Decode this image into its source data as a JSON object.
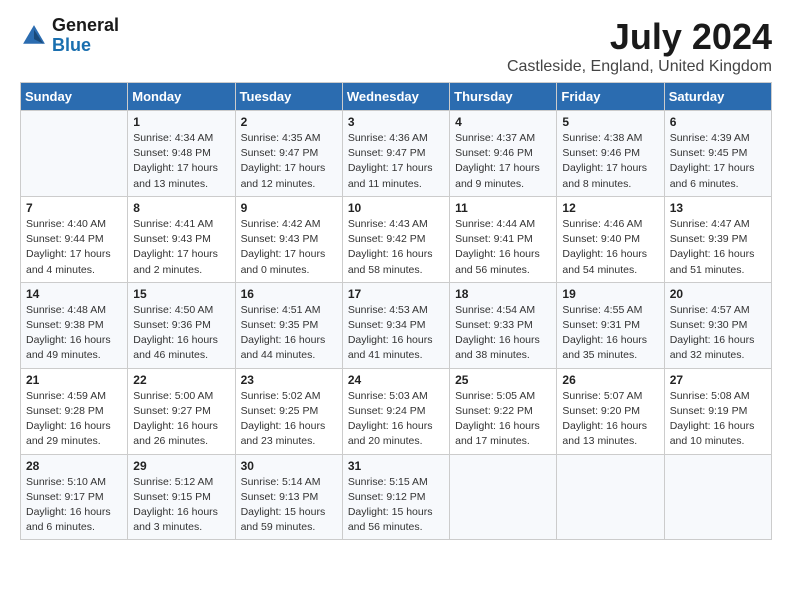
{
  "logo": {
    "general": "General",
    "blue": "Blue"
  },
  "title": "July 2024",
  "subtitle": "Castleside, England, United Kingdom",
  "headers": [
    "Sunday",
    "Monday",
    "Tuesday",
    "Wednesday",
    "Thursday",
    "Friday",
    "Saturday"
  ],
  "weeks": [
    [
      {
        "num": "",
        "sunrise": "",
        "sunset": "",
        "daylight": ""
      },
      {
        "num": "1",
        "sunrise": "Sunrise: 4:34 AM",
        "sunset": "Sunset: 9:48 PM",
        "daylight": "Daylight: 17 hours and 13 minutes."
      },
      {
        "num": "2",
        "sunrise": "Sunrise: 4:35 AM",
        "sunset": "Sunset: 9:47 PM",
        "daylight": "Daylight: 17 hours and 12 minutes."
      },
      {
        "num": "3",
        "sunrise": "Sunrise: 4:36 AM",
        "sunset": "Sunset: 9:47 PM",
        "daylight": "Daylight: 17 hours and 11 minutes."
      },
      {
        "num": "4",
        "sunrise": "Sunrise: 4:37 AM",
        "sunset": "Sunset: 9:46 PM",
        "daylight": "Daylight: 17 hours and 9 minutes."
      },
      {
        "num": "5",
        "sunrise": "Sunrise: 4:38 AM",
        "sunset": "Sunset: 9:46 PM",
        "daylight": "Daylight: 17 hours and 8 minutes."
      },
      {
        "num": "6",
        "sunrise": "Sunrise: 4:39 AM",
        "sunset": "Sunset: 9:45 PM",
        "daylight": "Daylight: 17 hours and 6 minutes."
      }
    ],
    [
      {
        "num": "7",
        "sunrise": "Sunrise: 4:40 AM",
        "sunset": "Sunset: 9:44 PM",
        "daylight": "Daylight: 17 hours and 4 minutes."
      },
      {
        "num": "8",
        "sunrise": "Sunrise: 4:41 AM",
        "sunset": "Sunset: 9:43 PM",
        "daylight": "Daylight: 17 hours and 2 minutes."
      },
      {
        "num": "9",
        "sunrise": "Sunrise: 4:42 AM",
        "sunset": "Sunset: 9:43 PM",
        "daylight": "Daylight: 17 hours and 0 minutes."
      },
      {
        "num": "10",
        "sunrise": "Sunrise: 4:43 AM",
        "sunset": "Sunset: 9:42 PM",
        "daylight": "Daylight: 16 hours and 58 minutes."
      },
      {
        "num": "11",
        "sunrise": "Sunrise: 4:44 AM",
        "sunset": "Sunset: 9:41 PM",
        "daylight": "Daylight: 16 hours and 56 minutes."
      },
      {
        "num": "12",
        "sunrise": "Sunrise: 4:46 AM",
        "sunset": "Sunset: 9:40 PM",
        "daylight": "Daylight: 16 hours and 54 minutes."
      },
      {
        "num": "13",
        "sunrise": "Sunrise: 4:47 AM",
        "sunset": "Sunset: 9:39 PM",
        "daylight": "Daylight: 16 hours and 51 minutes."
      }
    ],
    [
      {
        "num": "14",
        "sunrise": "Sunrise: 4:48 AM",
        "sunset": "Sunset: 9:38 PM",
        "daylight": "Daylight: 16 hours and 49 minutes."
      },
      {
        "num": "15",
        "sunrise": "Sunrise: 4:50 AM",
        "sunset": "Sunset: 9:36 PM",
        "daylight": "Daylight: 16 hours and 46 minutes."
      },
      {
        "num": "16",
        "sunrise": "Sunrise: 4:51 AM",
        "sunset": "Sunset: 9:35 PM",
        "daylight": "Daylight: 16 hours and 44 minutes."
      },
      {
        "num": "17",
        "sunrise": "Sunrise: 4:53 AM",
        "sunset": "Sunset: 9:34 PM",
        "daylight": "Daylight: 16 hours and 41 minutes."
      },
      {
        "num": "18",
        "sunrise": "Sunrise: 4:54 AM",
        "sunset": "Sunset: 9:33 PM",
        "daylight": "Daylight: 16 hours and 38 minutes."
      },
      {
        "num": "19",
        "sunrise": "Sunrise: 4:55 AM",
        "sunset": "Sunset: 9:31 PM",
        "daylight": "Daylight: 16 hours and 35 minutes."
      },
      {
        "num": "20",
        "sunrise": "Sunrise: 4:57 AM",
        "sunset": "Sunset: 9:30 PM",
        "daylight": "Daylight: 16 hours and 32 minutes."
      }
    ],
    [
      {
        "num": "21",
        "sunrise": "Sunrise: 4:59 AM",
        "sunset": "Sunset: 9:28 PM",
        "daylight": "Daylight: 16 hours and 29 minutes."
      },
      {
        "num": "22",
        "sunrise": "Sunrise: 5:00 AM",
        "sunset": "Sunset: 9:27 PM",
        "daylight": "Daylight: 16 hours and 26 minutes."
      },
      {
        "num": "23",
        "sunrise": "Sunrise: 5:02 AM",
        "sunset": "Sunset: 9:25 PM",
        "daylight": "Daylight: 16 hours and 23 minutes."
      },
      {
        "num": "24",
        "sunrise": "Sunrise: 5:03 AM",
        "sunset": "Sunset: 9:24 PM",
        "daylight": "Daylight: 16 hours and 20 minutes."
      },
      {
        "num": "25",
        "sunrise": "Sunrise: 5:05 AM",
        "sunset": "Sunset: 9:22 PM",
        "daylight": "Daylight: 16 hours and 17 minutes."
      },
      {
        "num": "26",
        "sunrise": "Sunrise: 5:07 AM",
        "sunset": "Sunset: 9:20 PM",
        "daylight": "Daylight: 16 hours and 13 minutes."
      },
      {
        "num": "27",
        "sunrise": "Sunrise: 5:08 AM",
        "sunset": "Sunset: 9:19 PM",
        "daylight": "Daylight: 16 hours and 10 minutes."
      }
    ],
    [
      {
        "num": "28",
        "sunrise": "Sunrise: 5:10 AM",
        "sunset": "Sunset: 9:17 PM",
        "daylight": "Daylight: 16 hours and 6 minutes."
      },
      {
        "num": "29",
        "sunrise": "Sunrise: 5:12 AM",
        "sunset": "Sunset: 9:15 PM",
        "daylight": "Daylight: 16 hours and 3 minutes."
      },
      {
        "num": "30",
        "sunrise": "Sunrise: 5:14 AM",
        "sunset": "Sunset: 9:13 PM",
        "daylight": "Daylight: 15 hours and 59 minutes."
      },
      {
        "num": "31",
        "sunrise": "Sunrise: 5:15 AM",
        "sunset": "Sunset: 9:12 PM",
        "daylight": "Daylight: 15 hours and 56 minutes."
      },
      {
        "num": "",
        "sunrise": "",
        "sunset": "",
        "daylight": ""
      },
      {
        "num": "",
        "sunrise": "",
        "sunset": "",
        "daylight": ""
      },
      {
        "num": "",
        "sunrise": "",
        "sunset": "",
        "daylight": ""
      }
    ]
  ]
}
